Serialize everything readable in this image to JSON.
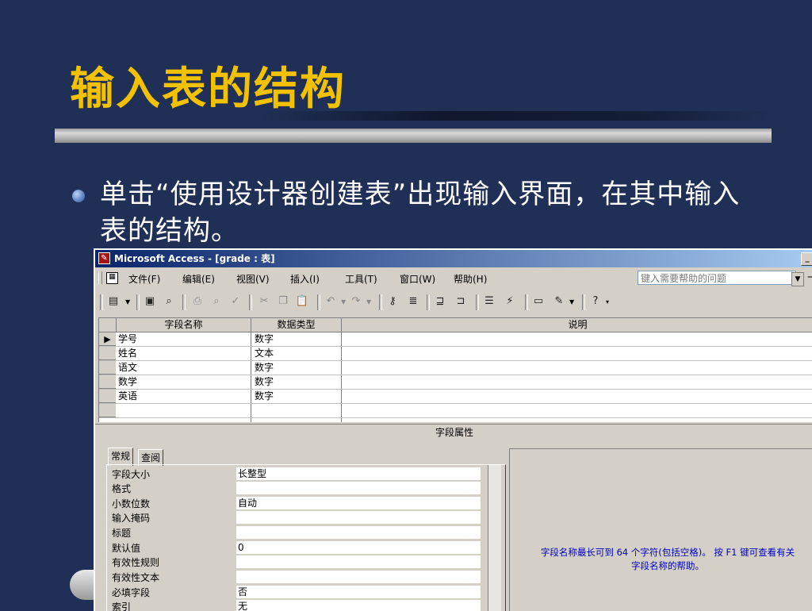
{
  "slide": {
    "title": "输入表的结构",
    "bullet": "单击“使用设计器创建表”出现输入界面，在其中输入表的结构。"
  },
  "window": {
    "title": "Microsoft Access - [grade : 表]",
    "menu": [
      "文件(F)",
      "编辑(E)",
      "视图(V)",
      "插入(I)",
      "工具(T)",
      "窗口(W)",
      "帮助(H)"
    ],
    "help_placeholder": "键入需要帮助的问题"
  },
  "grid": {
    "headers": [
      "字段名称",
      "数据类型",
      "说明"
    ],
    "rows": [
      {
        "name": "学号",
        "type": "数字"
      },
      {
        "name": "姓名",
        "type": "文本"
      },
      {
        "name": "语文",
        "type": "数字"
      },
      {
        "name": "数学",
        "type": "数字"
      },
      {
        "name": "英语",
        "type": "数字"
      }
    ]
  },
  "properties": {
    "section_label": "字段属性",
    "tabs": [
      "常规",
      "查阅"
    ],
    "rows": [
      {
        "label": "字段大小",
        "value": "长整型"
      },
      {
        "label": "格式",
        "value": ""
      },
      {
        "label": "小数位数",
        "value": "自动"
      },
      {
        "label": "输入掩码",
        "value": ""
      },
      {
        "label": "标题",
        "value": ""
      },
      {
        "label": "默认值",
        "value": "0"
      },
      {
        "label": "有效性规则",
        "value": ""
      },
      {
        "label": "有效性文本",
        "value": ""
      },
      {
        "label": "必填字段",
        "value": "否"
      },
      {
        "label": "索引",
        "value": "无"
      }
    ],
    "help_line1": "字段名称最长可到 64 个字符(包括空格)。 按 F1 键可查看有关",
    "help_line2": "字段名称的帮助。"
  }
}
